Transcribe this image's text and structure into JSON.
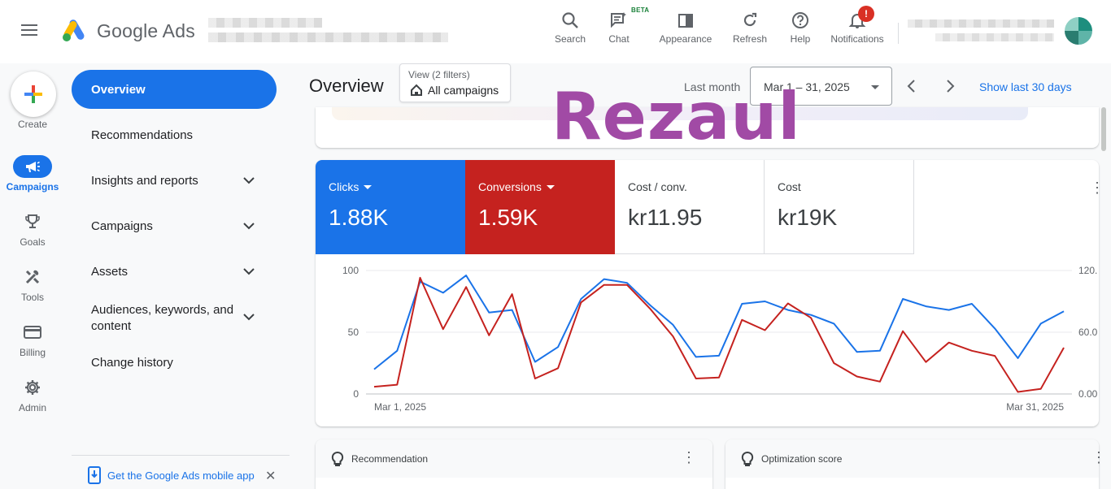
{
  "header": {
    "brand": "Google Ads",
    "tools": [
      {
        "id": "search",
        "label": "Search",
        "icon": "search-icon"
      },
      {
        "id": "chat",
        "label": "Chat",
        "icon": "chat-icon",
        "badge": "BETA"
      },
      {
        "id": "appearance",
        "label": "Appearance",
        "icon": "appearance-icon"
      },
      {
        "id": "refresh",
        "label": "Refresh",
        "icon": "refresh-icon"
      },
      {
        "id": "help",
        "label": "Help",
        "icon": "help-icon"
      },
      {
        "id": "notifications",
        "label": "Notifications",
        "icon": "bell-icon",
        "alert": "!"
      }
    ]
  },
  "rail": {
    "create": "Create",
    "items": [
      {
        "label": "Campaigns",
        "icon": "megaphone-icon",
        "active": true
      },
      {
        "label": "Goals",
        "icon": "trophy-icon"
      },
      {
        "label": "Tools",
        "icon": "tools-icon"
      },
      {
        "label": "Billing",
        "icon": "credit-card-icon"
      },
      {
        "label": "Admin",
        "icon": "gear-icon"
      }
    ]
  },
  "nav": {
    "active": "Overview",
    "items": [
      {
        "label": "Recommendations",
        "expandable": false
      },
      {
        "label": "Insights and reports",
        "expandable": true
      },
      {
        "label": "Campaigns",
        "expandable": true
      },
      {
        "label": "Assets",
        "expandable": true
      },
      {
        "label": "Audiences, keywords, and content",
        "label_line1": "Audiences, keywords, and",
        "label_line2": "content",
        "expandable": true
      },
      {
        "label": "Change history",
        "expandable": false
      }
    ],
    "app_promo": "Get the Google Ads mobile app",
    "app_close": "✕"
  },
  "main": {
    "title": "Overview",
    "filter": {
      "sub": "View (2 filters)",
      "main": "All campaigns"
    },
    "range_label": "Last month",
    "range_value": "Mar 1 – 31, 2025",
    "show_last": "Show last 30 days",
    "watermark": "Rezaul"
  },
  "metrics": [
    {
      "name": "Clicks",
      "value": "1.88K",
      "style": "blue",
      "dropdown": true
    },
    {
      "name": "Conversions",
      "value": "1.59K",
      "style": "red",
      "dropdown": true
    },
    {
      "name": "Cost / conv.",
      "value": "kr11.95",
      "style": "plain",
      "dropdown": false
    },
    {
      "name": "Cost",
      "value": "kr19K",
      "style": "plain",
      "dropdown": false
    }
  ],
  "chart_data": {
    "type": "line",
    "x_start_label": "Mar 1, 2025",
    "x_end_label": "Mar 31, 2025",
    "x": [
      1,
      2,
      3,
      4,
      5,
      6,
      7,
      8,
      9,
      10,
      11,
      12,
      13,
      14,
      15,
      16,
      17,
      18,
      19,
      20,
      21,
      22,
      23,
      24,
      25,
      26,
      27,
      28,
      29,
      30,
      31
    ],
    "y_left_ticks": [
      "100",
      "50",
      "0"
    ],
    "y_right_ticks": [
      "120.",
      "60.0",
      "0.00"
    ],
    "y_left_range": [
      0,
      100
    ],
    "y_right_range": [
      0,
      120
    ],
    "series": [
      {
        "name": "Clicks",
        "color": "#1a73e8",
        "axis": "left",
        "values": [
          20,
          35,
          91,
          82,
          96,
          66,
          68,
          26,
          38,
          77,
          93,
          90,
          72,
          56,
          30,
          31,
          73,
          75,
          68,
          64,
          57,
          34,
          35,
          77,
          71,
          68,
          73,
          53,
          29,
          57,
          67
        ]
      },
      {
        "name": "Conversions",
        "color": "#c5221f",
        "axis": "right",
        "values": [
          7,
          9,
          113,
          63,
          104,
          57,
          97,
          15,
          25,
          89,
          106,
          106,
          83,
          56,
          15,
          16,
          72,
          62,
          88,
          74,
          30,
          17,
          12,
          61,
          31,
          50,
          42,
          37,
          2,
          5,
          45
        ]
      }
    ],
    "grid": true
  },
  "bottom_cards": [
    {
      "title": "Recommendation",
      "icon": "lightbulb-icon"
    },
    {
      "title": "Optimization score",
      "icon": "lightbulb-icon"
    }
  ]
}
